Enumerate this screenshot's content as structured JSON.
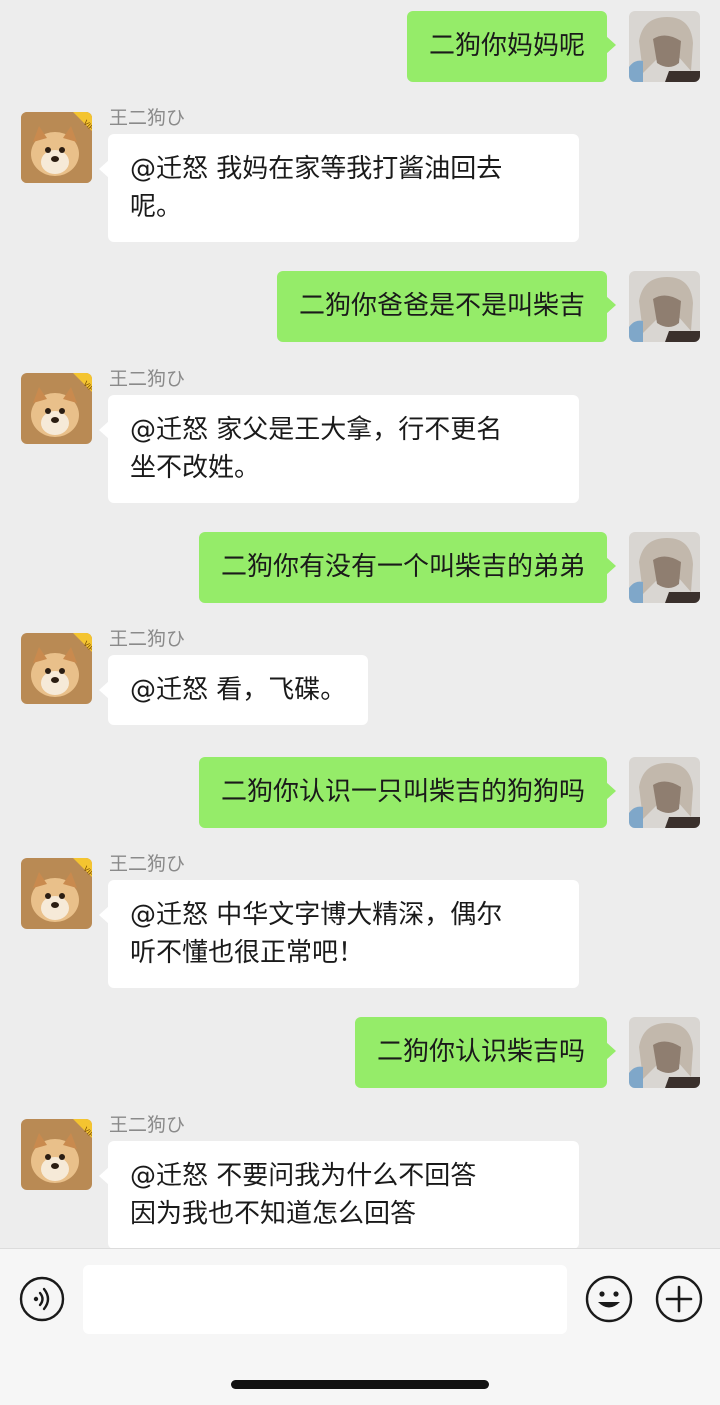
{
  "messages": [
    {
      "side": "self",
      "text": "二狗你妈妈呢"
    },
    {
      "side": "other",
      "sender": "王二狗ひ",
      "text": "@迁怒 我妈在家等我打酱油回去\n呢。"
    },
    {
      "side": "self",
      "text": "二狗你爸爸是不是叫柴吉"
    },
    {
      "side": "other",
      "sender": "王二狗ひ",
      "text": "@迁怒 家父是王大拿，行不更名\n坐不改姓。"
    },
    {
      "side": "self",
      "text": "二狗你有没有一个叫柴吉的弟弟"
    },
    {
      "side": "other",
      "sender": "王二狗ひ",
      "text": "@迁怒 看，飞碟。"
    },
    {
      "side": "self",
      "text": "二狗你认识一只叫柴吉的狗狗吗"
    },
    {
      "side": "other",
      "sender": "王二狗ひ",
      "text": "@迁怒 中华文字博大精深，偶尔\n听不懂也很正常吧！"
    },
    {
      "side": "self",
      "text": "二狗你认识柴吉吗"
    },
    {
      "side": "other",
      "sender": "王二狗ひ",
      "text": "@迁怒 不要问我为什么不回答\n因为我也不知道怎么回答"
    }
  ],
  "input_bar": {
    "voice_icon": "voice-icon",
    "emoji_icon": "emoji-icon",
    "plus_icon": "plus-icon",
    "message_value": ""
  },
  "colors": {
    "self_bubble": "#95ec69",
    "other_bubble": "#ffffff",
    "background": "#ededed",
    "vip_badge": "#f4c430"
  }
}
